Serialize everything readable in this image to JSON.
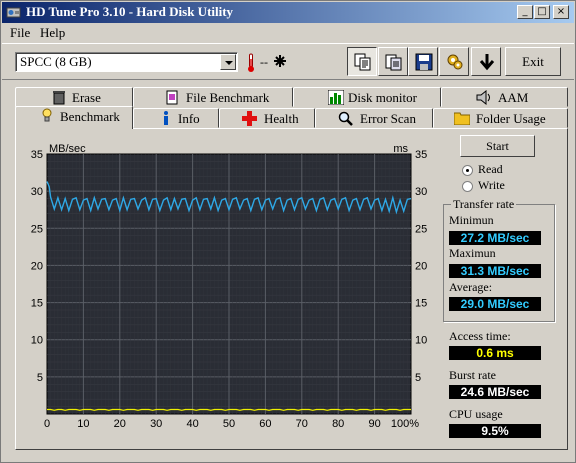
{
  "window": {
    "title": "HD Tune Pro 3.10 - Hard Disk Utility",
    "minimize": "_",
    "maximize": "□",
    "close": "×"
  },
  "menu": {
    "file": "File",
    "help": "Help"
  },
  "toolbar": {
    "drive": "SPCC (8 GB)",
    "temperature": "--",
    "exit_label": "Exit"
  },
  "tabs_top": [
    "Erase",
    "File Benchmark",
    "Disk monitor",
    "AAM"
  ],
  "tabs_bottom": [
    "Benchmark",
    "Info",
    "Health",
    "Error Scan",
    "Folder Usage"
  ],
  "benchmark": {
    "start_label": "Start",
    "read_label": "Read",
    "write_label": "Write",
    "read_selected": true,
    "transfer_rate_title": "Transfer rate",
    "minimum_label": "Minimun",
    "minimum_value": "27.2 MB/sec",
    "maximum_label": "Maximun",
    "maximum_value": "31.3 MB/sec",
    "average_label": "Average:",
    "average_value": "29.0 MB/sec",
    "access_label": "Access time:",
    "access_value": "0.6 ms",
    "burst_label": "Burst rate",
    "burst_value": "24.6 MB/sec",
    "cpu_label": "CPU usage",
    "cpu_value": "9.5%"
  },
  "chart_data": {
    "type": "line",
    "ylabel_left": "MB/sec",
    "ylabel_right": "ms",
    "ylim": [
      0,
      35
    ],
    "xlim": [
      0,
      100
    ],
    "y_ticks": [
      "5",
      "10",
      "15",
      "20",
      "25",
      "30",
      "35"
    ],
    "x_ticks": [
      "0",
      "10",
      "20",
      "30",
      "40",
      "50",
      "60",
      "70",
      "80",
      "90",
      "100%"
    ],
    "grid": true,
    "series": [
      {
        "color": "#2ea8e6",
        "x": [
          0,
          0.6,
          1,
          2,
          3,
          4,
          5,
          6,
          7,
          8,
          9,
          10,
          11,
          12,
          13,
          14,
          15,
          16,
          17,
          18,
          19,
          20,
          21,
          22,
          23,
          24,
          25,
          26,
          27,
          28,
          29,
          30,
          31,
          32,
          33,
          34,
          35,
          36,
          37,
          38,
          39,
          40,
          41,
          42,
          43,
          44,
          45,
          46,
          47,
          48,
          49,
          50,
          51,
          52,
          53,
          54,
          55,
          56,
          57,
          58,
          59,
          60,
          61,
          62,
          63,
          64,
          65,
          66,
          67,
          68,
          69,
          70,
          71,
          72,
          73,
          74,
          75,
          76,
          77,
          78,
          79,
          80,
          81,
          82,
          83,
          84,
          85,
          86,
          87,
          88,
          89,
          90,
          91,
          92,
          93,
          94,
          95,
          96,
          97,
          98,
          99,
          100
        ],
        "values": [
          31.3,
          30.6,
          29.2,
          27.6,
          29.1,
          27.5,
          29.0,
          27.4,
          28.9,
          29.1,
          27.5,
          28.8,
          29.0,
          27.4,
          29.1,
          27.6,
          28.9,
          29.0,
          27.5,
          28.8,
          29.0,
          27.4,
          29.1,
          27.5,
          28.9,
          29.0,
          27.6,
          28.8,
          29.1,
          27.5,
          28.9,
          29.0,
          27.4,
          28.8,
          29.1,
          27.5,
          29.0,
          27.6,
          28.9,
          29.0,
          27.4,
          28.8,
          29.1,
          27.5,
          28.9,
          29.0,
          27.6,
          29.1,
          27.4,
          28.8,
          29.0,
          27.5,
          28.9,
          29.1,
          27.6,
          28.8,
          29.0,
          27.4,
          28.9,
          29.1,
          27.5,
          28.8,
          29.0,
          27.6,
          28.9,
          29.1,
          27.4,
          28.8,
          29.0,
          27.5,
          28.9,
          29.1,
          27.6,
          28.8,
          29.0,
          27.4,
          28.9,
          29.1,
          27.5,
          28.8,
          29.0,
          27.6,
          28.9,
          29.1,
          27.4,
          28.8,
          29.0,
          27.5,
          28.9,
          29.1,
          27.6,
          28.8,
          29.0,
          27.4,
          28.9,
          27.3,
          29.1,
          27.2,
          28.8,
          27.3,
          28.9,
          29.0
        ]
      },
      {
        "color": "#f0f000",
        "x": [
          0,
          1,
          2,
          3,
          4,
          5,
          6,
          7,
          8,
          9,
          10,
          11,
          12,
          13,
          14,
          15,
          16,
          17,
          18,
          19,
          20,
          21,
          22,
          23,
          24,
          25,
          26,
          27,
          28,
          29,
          30,
          31,
          32,
          33,
          34,
          35,
          36,
          37,
          38,
          39,
          40,
          41,
          42,
          43,
          44,
          45,
          46,
          47,
          48,
          49,
          50,
          51,
          52,
          53,
          54,
          55,
          56,
          57,
          58,
          59,
          60,
          61,
          62,
          63,
          64,
          65,
          66,
          67,
          68,
          69,
          70,
          71,
          72,
          73,
          74,
          75,
          76,
          77,
          78,
          79,
          80,
          81,
          82,
          83,
          84,
          85,
          86,
          87,
          88,
          89,
          90,
          91,
          92,
          93,
          94,
          95,
          96,
          97,
          98,
          99,
          100
        ],
        "values": [
          0.6,
          0.6,
          0.5,
          0.6,
          0.6,
          0.5,
          0.6,
          0.6,
          0.6,
          0.5,
          0.6,
          0.6,
          0.6,
          0.5,
          0.6,
          0.6,
          0.6,
          0.5,
          0.6,
          0.6,
          0.6,
          0.5,
          0.6,
          0.6,
          0.6,
          0.5,
          0.6,
          0.6,
          0.6,
          0.5,
          0.6,
          0.6,
          0.6,
          0.5,
          0.6,
          0.6,
          0.6,
          0.5,
          0.6,
          0.6,
          0.6,
          0.5,
          0.6,
          0.6,
          0.6,
          0.5,
          0.6,
          0.6,
          0.6,
          0.5,
          0.6,
          0.6,
          0.6,
          0.5,
          0.6,
          0.6,
          0.6,
          0.5,
          0.6,
          0.6,
          0.6,
          0.5,
          0.6,
          0.6,
          0.6,
          0.5,
          0.6,
          0.6,
          0.6,
          0.5,
          0.6,
          0.6,
          0.6,
          0.5,
          0.6,
          0.6,
          0.6,
          0.5,
          0.6,
          0.6,
          0.6,
          0.5,
          0.6,
          0.6,
          0.6,
          0.5,
          0.6,
          0.6,
          0.6,
          0.5,
          0.6,
          0.6,
          0.6,
          0.5,
          0.6,
          0.6,
          0.6,
          0.5,
          0.6,
          0.6,
          0.6
        ]
      }
    ]
  }
}
